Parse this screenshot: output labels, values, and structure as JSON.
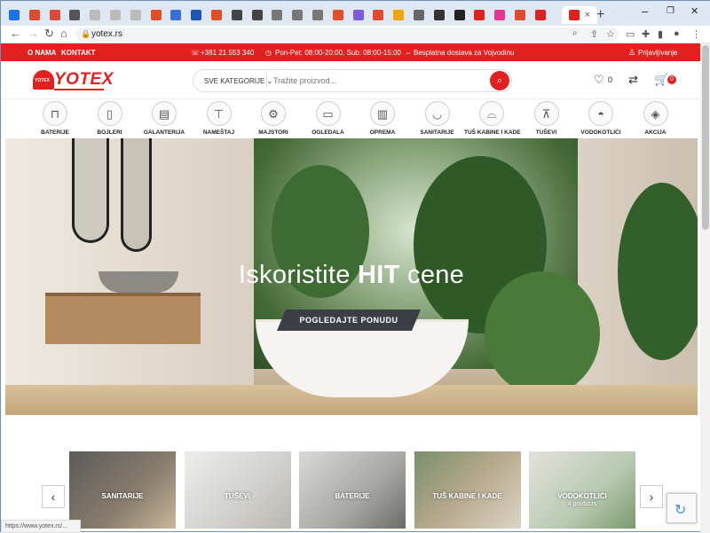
{
  "browser": {
    "tab_favicons": [
      "#1a73e8",
      "#e04a2d",
      "#d94c3d",
      "#555",
      "#bbb",
      "#bbb",
      "#bbb",
      "#e14f28",
      "#3a6fd8",
      "#1d56b8",
      "#e14f28",
      "#444",
      "#444",
      "#777",
      "#777",
      "#777",
      "#e14f28",
      "#7e5bd8",
      "#e04a2d",
      "#f0a600",
      "#666",
      "#333",
      "#222",
      "#e32020",
      "#e8368f",
      "#e04a2d",
      "#e32020"
    ],
    "active_tab_close": "×",
    "new_tab": "+",
    "url": "yotex.rs",
    "min": "–",
    "restore": "❐",
    "close": "✕"
  },
  "topbar": {
    "about": "O NAMA",
    "contact": "KONTAKT",
    "phone": "+381 21 553 340",
    "hours": "Pon-Pet: 08:00-20:00, Sub: 08:00-15:00",
    "delivery": "Besplatna dostava za Vojvodinu",
    "login": "Prijavljivanje"
  },
  "header": {
    "logo_text": "YOTEX",
    "logo_badge": "YOTEX",
    "category_select": "SVE KATEGORIJE",
    "search_placeholder": "Tražite proizvod...",
    "wishlist_count": "0",
    "cart_count": "0"
  },
  "categories": [
    {
      "label": "BATERIJE",
      "icon": "faucet-icon"
    },
    {
      "label": "BOJLERI",
      "icon": "boiler-icon"
    },
    {
      "label": "GALANTERIJA",
      "icon": "towel-holder-icon"
    },
    {
      "label": "NAMEŠTAJ",
      "icon": "vanity-icon"
    },
    {
      "label": "MAJSTORI",
      "icon": "plumber-icon"
    },
    {
      "label": "OGLEDALA",
      "icon": "mirror-icon"
    },
    {
      "label": "OPREMA",
      "icon": "bin-icon"
    },
    {
      "label": "SANITARIJE",
      "icon": "sink-icon"
    },
    {
      "label": "TUŠ KABINE I KADE",
      "icon": "bathtub-icon"
    },
    {
      "label": "TUŠEVI",
      "icon": "shower-icon"
    },
    {
      "label": "VODOKOTLIĆI",
      "icon": "toilet-icon"
    },
    {
      "label": "AKCIJA",
      "icon": "tag-icon"
    }
  ],
  "hero": {
    "title_before": "Iskoristite ",
    "title_bold": "HIT",
    "title_after": " cene",
    "cta": "POGLEDAJTE PONUDU"
  },
  "carousel": [
    {
      "title": "SANITARIJE",
      "sub": ""
    },
    {
      "title": "TUŠEVI",
      "sub": ""
    },
    {
      "title": "BATERIJE",
      "sub": ""
    },
    {
      "title": "TUŠ KABINE I KADE",
      "sub": ""
    },
    {
      "title": "VODOKOTLIĆI",
      "sub": "4 products"
    }
  ],
  "status_url": "https://www.yotex.rs/..."
}
